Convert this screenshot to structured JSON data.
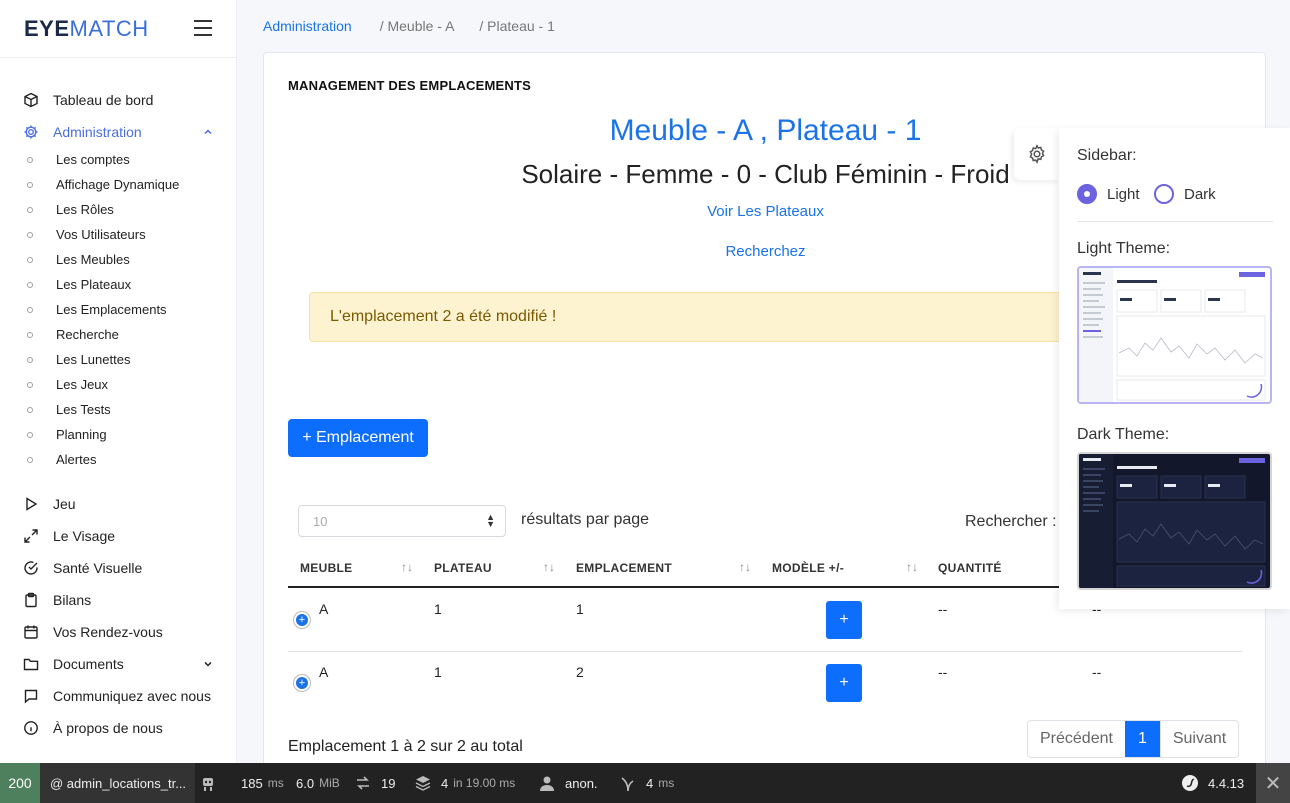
{
  "logo": {
    "bold": "EYE",
    "light": "MATCH"
  },
  "sidebar": {
    "items": [
      {
        "label": "Tableau de bord",
        "icon": "cube-icon"
      },
      {
        "label": "Administration",
        "icon": "gear-icon",
        "active": true
      },
      {
        "label": "Jeu",
        "icon": "play-icon"
      },
      {
        "label": "Le Visage",
        "icon": "expand-arrows-icon"
      },
      {
        "label": "Santé Visuelle",
        "icon": "check-circle-icon"
      },
      {
        "label": "Bilans",
        "icon": "clipboard-icon"
      },
      {
        "label": "Vos Rendez-vous",
        "icon": "calendar-icon"
      },
      {
        "label": "Documents",
        "icon": "folder-icon"
      },
      {
        "label": "Communiquez avec nous",
        "icon": "message-icon"
      },
      {
        "label": "À propos de nous",
        "icon": "info-icon"
      }
    ],
    "admin_sub": [
      "Les comptes",
      "Affichage Dynamique",
      "Les Rôles",
      "Vos Utilisateurs",
      "Les Meubles",
      "Les Plateaux",
      "Les Emplacements",
      "Recherche",
      "Les Lunettes",
      "Les Jeux",
      "Les Tests",
      "Planning",
      "Alertes"
    ]
  },
  "breadcrumb": {
    "root": "Administration",
    "level1": "/ Meuble - A",
    "level2": "/ Plateau - 1"
  },
  "card": {
    "title": "MANAGEMENT DES EMPLACEMENTS",
    "main_title": "Meuble - A , Plateau - 1",
    "sub_title": "Solaire - Femme - 0 - Club Féminin - Froid",
    "link_plateaux": "Voir Les Plateaux",
    "link_search": "Recherchez",
    "alert": "L'emplacement 2 a été modifié !",
    "add_button": "+ Emplacement",
    "page_size": "10",
    "per_page_label": "résultats par page",
    "search_label": "Rechercher :"
  },
  "table": {
    "headers": [
      "MEUBLE",
      "PLATEAU",
      "EMPLACEMENT",
      "MODÈLE +/-",
      "QUANTITÉ"
    ],
    "rows": [
      {
        "meuble": "A",
        "plateau": "1",
        "emplacement": "1",
        "model_btn": "+",
        "quantite": "--",
        "extra": "--"
      },
      {
        "meuble": "A",
        "plateau": "1",
        "emplacement": "2",
        "model_btn": "+",
        "quantite": "--",
        "extra": "--"
      }
    ],
    "summary": "Emplacement 1 à 2 sur 2 au total",
    "pager": {
      "prev": "Précédent",
      "current": "1",
      "next": "Suivant"
    }
  },
  "theme_panel": {
    "sidebar_label": "Sidebar:",
    "light": "Light",
    "dark": "Dark",
    "selected": "Light",
    "light_theme_label": "Light Theme:",
    "dark_theme_label": "Dark Theme:",
    "accent": "#6c63e0"
  },
  "toolbar": {
    "status": "200",
    "route": "@ admin_locations_tr...",
    "time": "185",
    "time_unit": "ms",
    "memory": "6.0",
    "memory_unit": "MiB",
    "requests": "19",
    "db": "4",
    "db_detail": "in 19.00 ms",
    "user": "anon.",
    "twig": "4",
    "twig_unit": "ms",
    "version": "4.4.13"
  },
  "colors": {
    "primary": "#0d6efd",
    "link": "#1a73e8",
    "alert_bg": "#fdf3d1",
    "toolbar_bg": "#222222",
    "status_ok": "#4f805d"
  }
}
